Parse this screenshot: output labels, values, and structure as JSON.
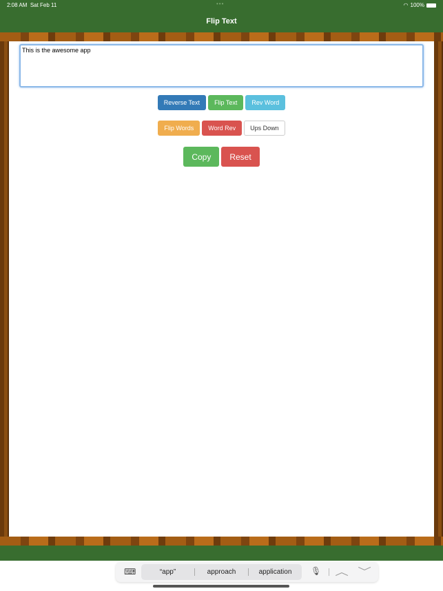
{
  "status_bar": {
    "time": "2:08 AM",
    "date": "Sat Feb 11",
    "battery": "100%"
  },
  "header": {
    "title": "Flip Text"
  },
  "input": {
    "value": "This is the awesome app"
  },
  "buttons": {
    "row1": [
      {
        "label": "Reverse Text",
        "color": "#337ab7"
      },
      {
        "label": "Flip Text",
        "color": "#5cb85c"
      },
      {
        "label": "Rev Word",
        "color": "#5bc0de"
      }
    ],
    "row2": [
      {
        "label": "Flip Words",
        "color": "#f0ad4e"
      },
      {
        "label": "Word Rev",
        "color": "#d9534f"
      },
      {
        "label": "Ups Down",
        "color": "#ffffff"
      }
    ],
    "row3": [
      {
        "label": "Copy",
        "color": "#5cb85c"
      },
      {
        "label": "Reset",
        "color": "#d9534f"
      }
    ]
  },
  "keyboard_bar": {
    "suggestions": [
      "“app”",
      "approach",
      "application"
    ]
  },
  "colors": {
    "nav_green": "#386d2f"
  }
}
